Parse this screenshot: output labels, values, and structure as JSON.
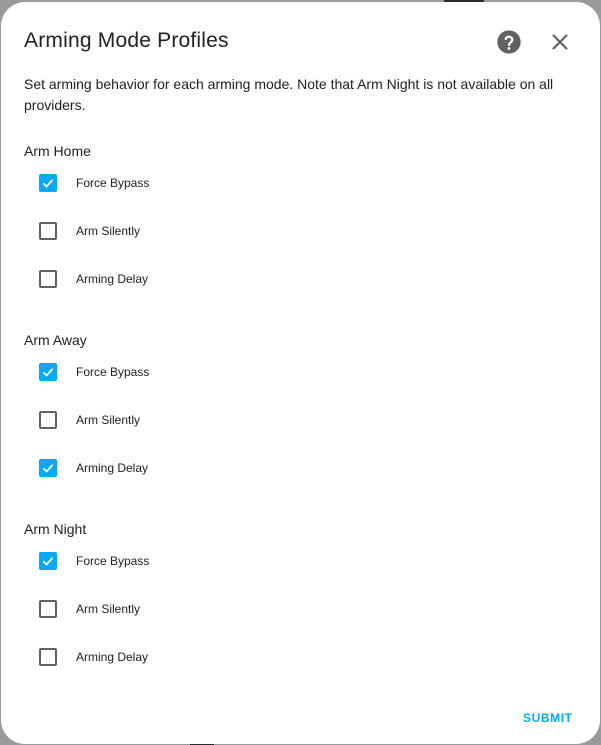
{
  "dialog": {
    "title": "Arming Mode Profiles",
    "description": "Set arming behavior for each arming mode. Note that Arm Night is not available on all providers.",
    "help_icon": "help-circle-icon",
    "close_icon": "close-icon",
    "submit_label": "SUBMIT"
  },
  "sections": [
    {
      "title": "Arm Home",
      "options": [
        {
          "label": "Force Bypass",
          "checked": true
        },
        {
          "label": "Arm Silently",
          "checked": false
        },
        {
          "label": "Arming Delay",
          "checked": false
        }
      ]
    },
    {
      "title": "Arm Away",
      "options": [
        {
          "label": "Force Bypass",
          "checked": true
        },
        {
          "label": "Arm Silently",
          "checked": false
        },
        {
          "label": "Arming Delay",
          "checked": true
        }
      ]
    },
    {
      "title": "Arm Night",
      "options": [
        {
          "label": "Force Bypass",
          "checked": true
        },
        {
          "label": "Arm Silently",
          "checked": false
        },
        {
          "label": "Arming Delay",
          "checked": false
        }
      ]
    }
  ],
  "colors": {
    "accent": "#03a9f4",
    "text": "#212121",
    "icon": "#616161"
  }
}
